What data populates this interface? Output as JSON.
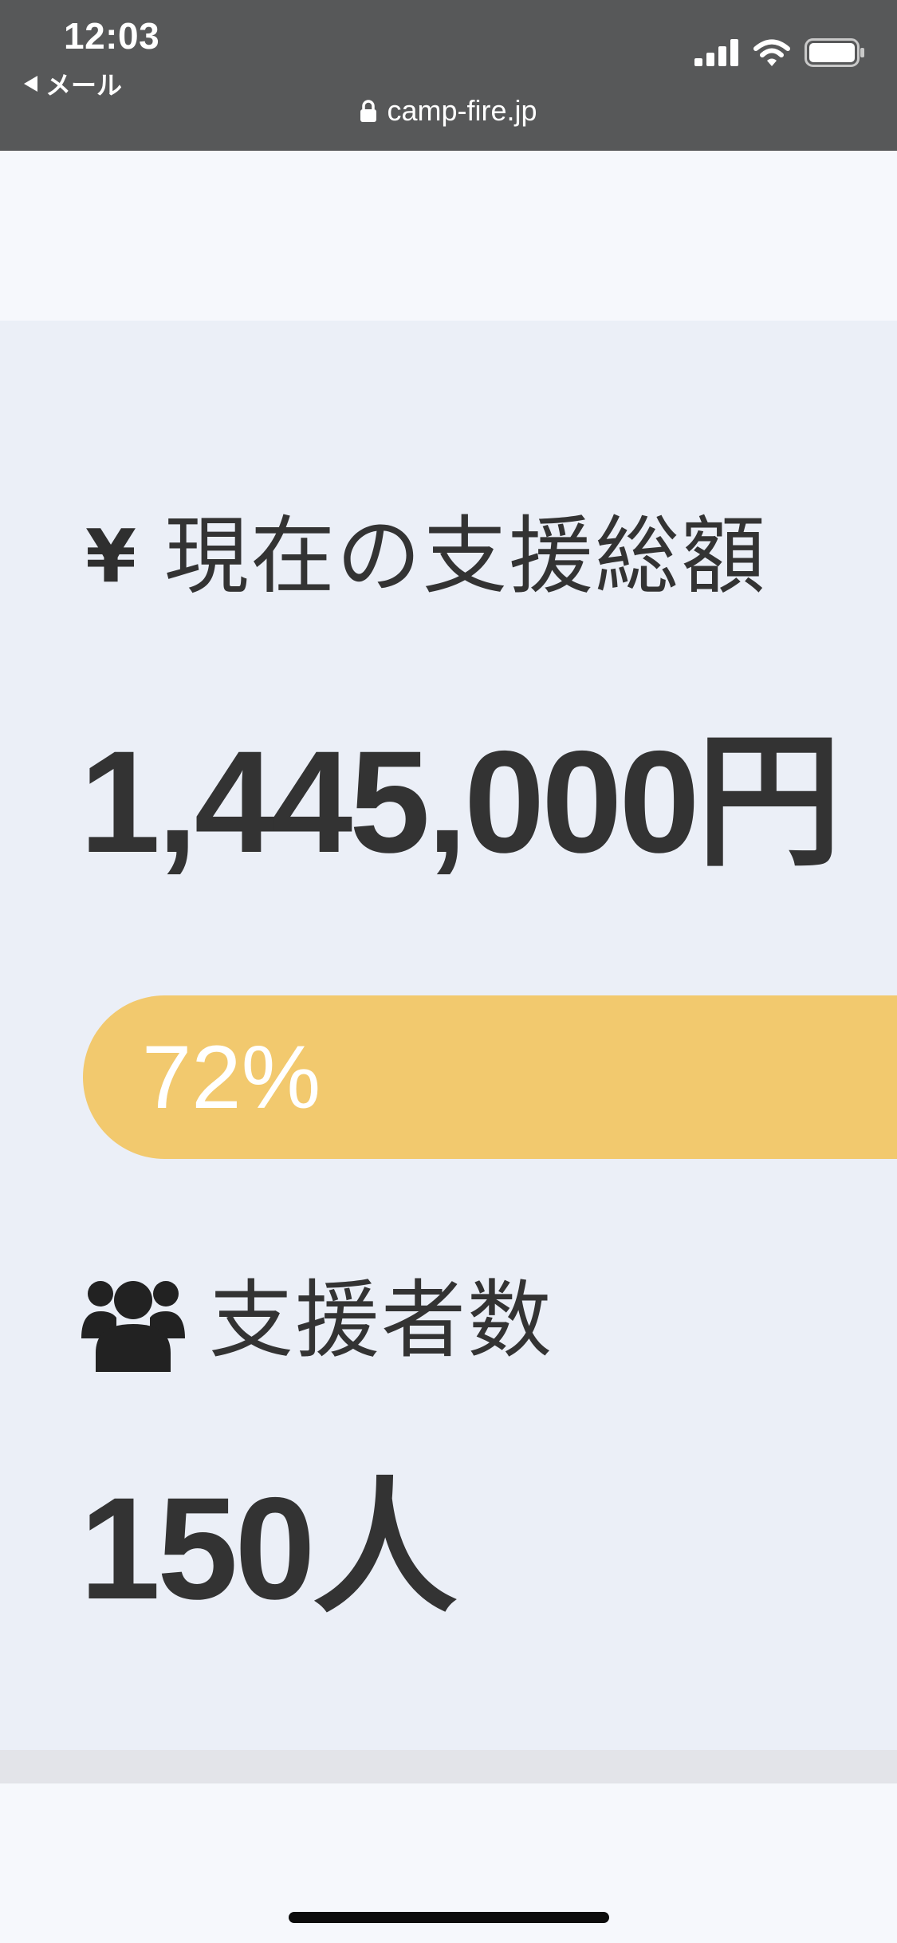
{
  "status_bar": {
    "time": "12:03",
    "back_label": "メール"
  },
  "browser": {
    "url": "camp-fire.jp"
  },
  "funding": {
    "currency_symbol": "¥",
    "title": "現在の支援総額",
    "amount": "1,445,000円",
    "progress_label": "72%",
    "progress_fraction": 0.72,
    "progress_color": "#f2c96e"
  },
  "backers": {
    "title": "支援者数",
    "count": "150人"
  },
  "icons": {
    "amount": "yen-icon",
    "backers": "users-icon",
    "url_lock": "lock-icon",
    "signal": "cellular-signal-icon",
    "wifi": "wifi-icon",
    "battery": "battery-icon"
  }
}
